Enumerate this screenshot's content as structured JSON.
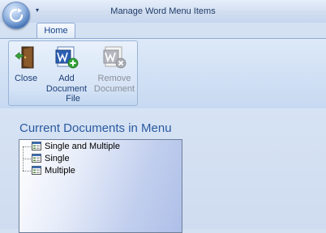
{
  "window": {
    "title": "Manage Word Menu Items"
  },
  "qat": {
    "arrow_glyph": "▾"
  },
  "tabs": [
    {
      "label": "Home",
      "active": true
    }
  ],
  "ribbon": {
    "group_label": "File",
    "buttons": {
      "close": {
        "label": "Close",
        "enabled": true
      },
      "add": {
        "label_line1": "Add",
        "label_line2": "Document",
        "enabled": true
      },
      "remove": {
        "label_line1": "Remove",
        "label_line2": "Document",
        "enabled": false
      }
    }
  },
  "main": {
    "section_title": "Current Documents in Menu",
    "tree_items": [
      {
        "label": "Single and Multiple"
      },
      {
        "label": "Single"
      },
      {
        "label": "Multiple"
      }
    ]
  },
  "colors": {
    "accent": "#2a5aa0",
    "ribbon_text": "#1c3f76",
    "disabled_text": "#8a8f98"
  }
}
